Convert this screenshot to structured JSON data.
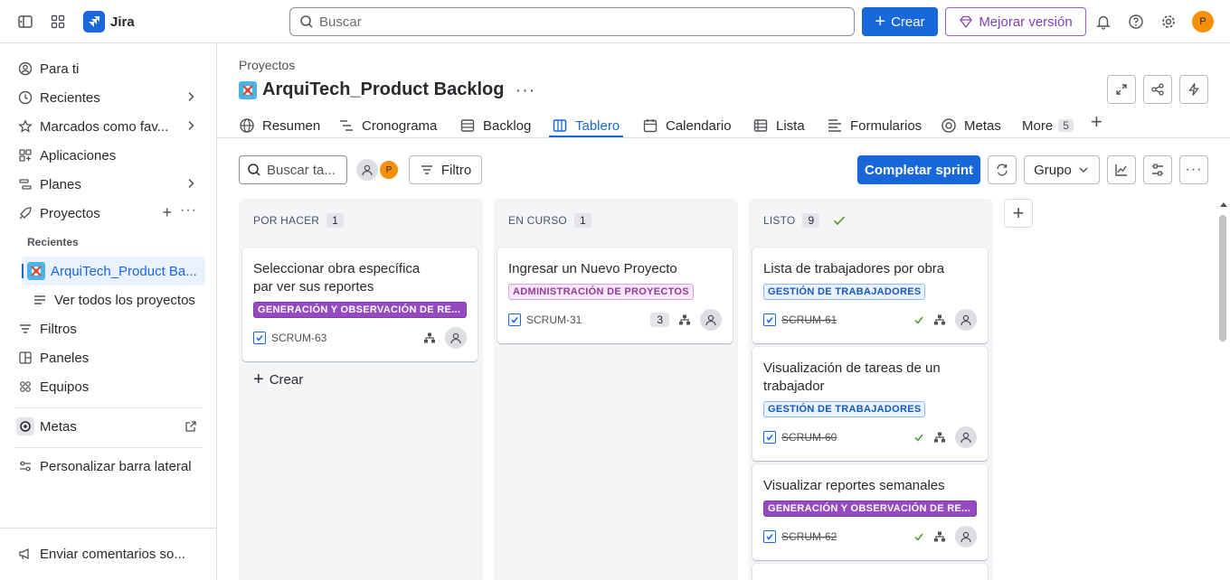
{
  "topbar": {
    "app_name": "Jira",
    "search_placeholder": "Buscar",
    "create_label": "Crear",
    "upgrade_label": "Mejorar versión",
    "avatar_initial": "P"
  },
  "sidebar": {
    "for_you": "Para ti",
    "recent": "Recientes",
    "starred": "Marcados como fav...",
    "apps": "Aplicaciones",
    "plans": "Planes",
    "projects": "Proyectos",
    "recent_header": "Recientes",
    "current_project": "ArquiTech_Product Ba...",
    "view_all": "Ver todos los proyectos",
    "filters": "Filtros",
    "dashboards": "Paneles",
    "teams": "Equipos",
    "goals": "Metas",
    "customize": "Personalizar barra lateral",
    "feedback": "Enviar comentarios so..."
  },
  "header": {
    "breadcrumb": "Proyectos",
    "title": "ArquiTech_Product Backlog"
  },
  "tabs": {
    "summary": "Resumen",
    "timeline": "Cronograma",
    "backlog": "Backlog",
    "board": "Tablero",
    "calendar": "Calendario",
    "list": "Lista",
    "forms": "Formularios",
    "goals": "Metas",
    "more": "More",
    "more_count": "5"
  },
  "toolbar": {
    "search_placeholder": "Buscar ta...",
    "avatar_initial": "P",
    "filter_label": "Filtro",
    "complete_sprint": "Completar sprint",
    "group_label": "Grupo"
  },
  "columns": {
    "todo": {
      "name": "POR HACER",
      "count": "1",
      "create_label": "Crear",
      "cards": [
        {
          "title": "Seleccionar obra específica par ver sus reportes",
          "label": "GENERACIÓN Y OBSERVACIÓN DE RE...",
          "key": "SCRUM-63"
        }
      ]
    },
    "in_progress": {
      "name": "EN CURSO",
      "count": "1",
      "cards": [
        {
          "title": "Ingresar un Nuevo Proyecto",
          "label": "ADMINISTRACIÓN DE PROYECTOS",
          "key": "SCRUM-31",
          "subtasks": "3"
        }
      ]
    },
    "done": {
      "name": "LISTO",
      "count": "9",
      "cards": [
        {
          "title": "Lista de trabajadores por obra",
          "label": "GESTIÓN DE TRABAJADORES",
          "key": "SCRUM-61"
        },
        {
          "title": "Visualización de tareas de un trabajador",
          "label": "GESTIÓN DE TRABAJADORES",
          "key": "SCRUM-60"
        },
        {
          "title": "Visualizar reportes semanales",
          "label": "GENERACIÓN Y OBSERVACIÓN DE RE...",
          "key": "SCRUM-62"
        }
      ]
    }
  },
  "colors": {
    "accent": "#1868db",
    "avatar": "#f79009",
    "upgrade": "#7e3fb8",
    "done_check": "#4a9a22"
  }
}
